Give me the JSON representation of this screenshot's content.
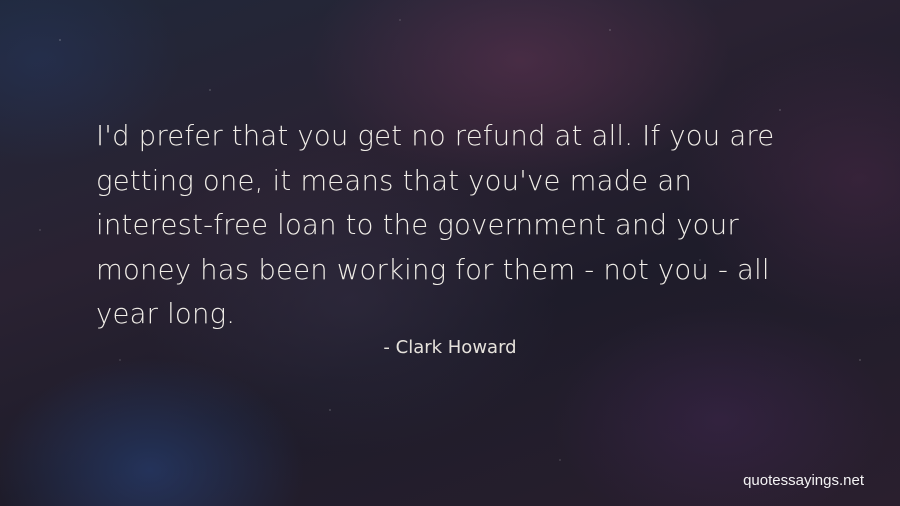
{
  "quote": {
    "text": "I'd prefer that you get no refund at all. If you are\ngetting one, it means that you've made an\ninterest-free loan to the government and your\nmoney has been working for them - not you - all\nyear long."
  },
  "author": "- Clark Howard",
  "watermark": "quotessayings.net",
  "colors": {
    "text": "#f1eee8",
    "background": "#1f1d2a"
  }
}
